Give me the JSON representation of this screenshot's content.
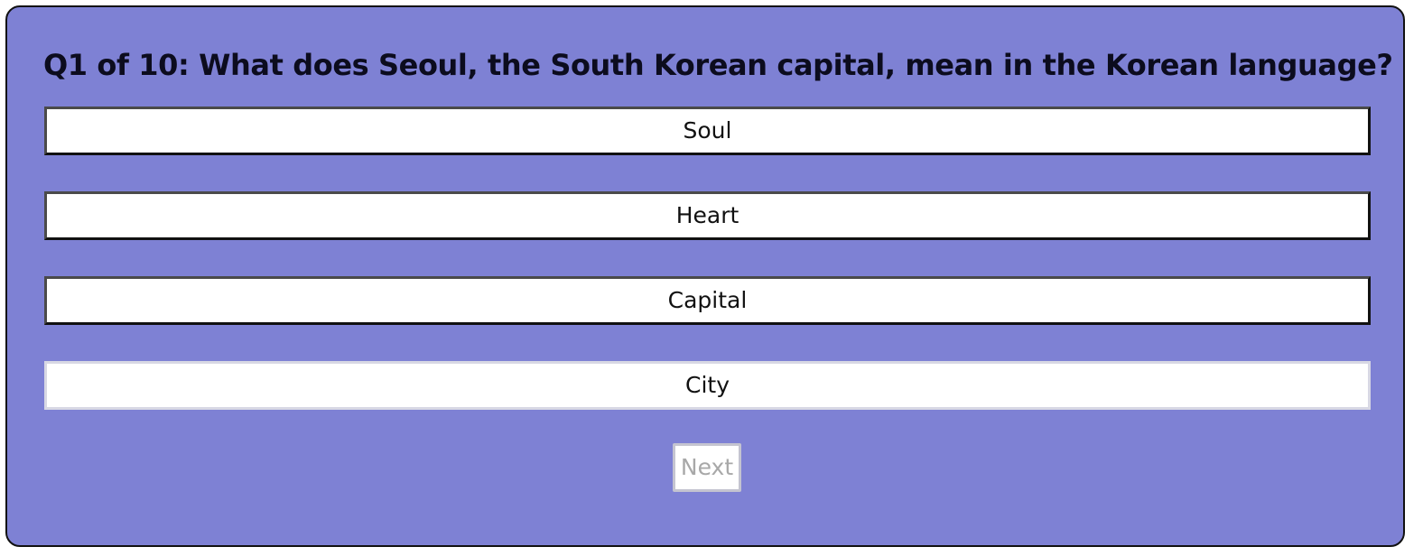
{
  "quiz": {
    "question": "Q1 of 10: What does Seoul, the South Korean capital, mean in the Korean language?",
    "answers": [
      {
        "label": "Soul"
      },
      {
        "label": "Heart"
      },
      {
        "label": "Capital"
      },
      {
        "label": "City"
      }
    ],
    "next_label": "Next",
    "next_disabled": true
  },
  "colors": {
    "card_background": "#7e81d4",
    "card_border": "#111111",
    "question_text": "#0c0c1e",
    "answer_background": "#ffffff",
    "next_text_disabled": "#a8a8a8"
  }
}
